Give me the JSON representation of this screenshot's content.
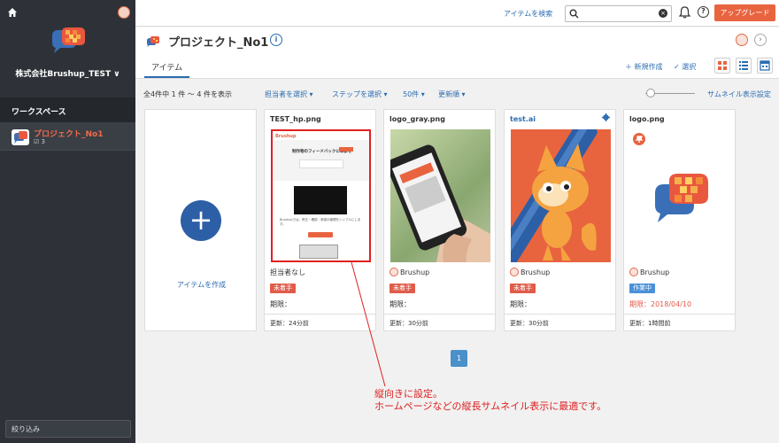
{
  "sidebar": {
    "company": "株式会社Brushup_TEST ∨",
    "workspace_label": "ワークスペース",
    "project": {
      "name": "プロジェクト_No1",
      "count": "3"
    },
    "filter_label": "絞り込み"
  },
  "topbar": {
    "search_label": "アイテムを検索",
    "upgrade_label": "アップグレード",
    "help": "?"
  },
  "header": {
    "title": "プロジェクト_No1",
    "tab": "アイテム",
    "new_label": "＋ 新規作成",
    "select_label": "✓ 選択"
  },
  "filterbar": {
    "count": "全4件中 1 件 〜 4 件を表示",
    "assignee": "担当者を選択 ▾",
    "step": "ステップを選択 ▾",
    "per_page": "50件 ▾",
    "sort": "更新順 ▾",
    "thumb_setting": "サムネイル表示設定"
  },
  "new_card": {
    "plus": "+",
    "label": "アイテムを作成"
  },
  "cards": [
    {
      "name": "TEST_hp.png",
      "assignee": "担当者なし",
      "status": "未着手",
      "due": "期限：",
      "updated": "更新：24分前"
    },
    {
      "name": "logo_gray.png",
      "assignee": "Brushup",
      "status": "未着手",
      "due": "期限：",
      "updated": "更新：30分前"
    },
    {
      "name": "test.ai",
      "assignee": "Brushup",
      "status": "未着手",
      "due": "期限：",
      "updated": "更新：30分前"
    },
    {
      "name": "logo.png",
      "assignee": "Brushup",
      "status": "作業中",
      "due": "期限：2018/04/10",
      "updated": "更新：1時間前"
    }
  ],
  "hp_preview": {
    "brand": "Brushup",
    "headline": "制作物のフィードバックに革新を",
    "body": "Brushupでは、修正・確認・承認の管理をシンプルにします。",
    "cta": "無料で試す"
  },
  "pager": "1",
  "annotation": {
    "line1": "縦向きに設定。",
    "line2": "ホームページなどの縦長サムネイル表示に最適です。"
  },
  "colors": {
    "accent": "#2b6cb0",
    "upgrade": "#e8643f",
    "status_todo": "#e05c4a",
    "status_doing": "#4a90d9",
    "sidebar_bg": "#2e3238",
    "annotation": "#e02020"
  }
}
